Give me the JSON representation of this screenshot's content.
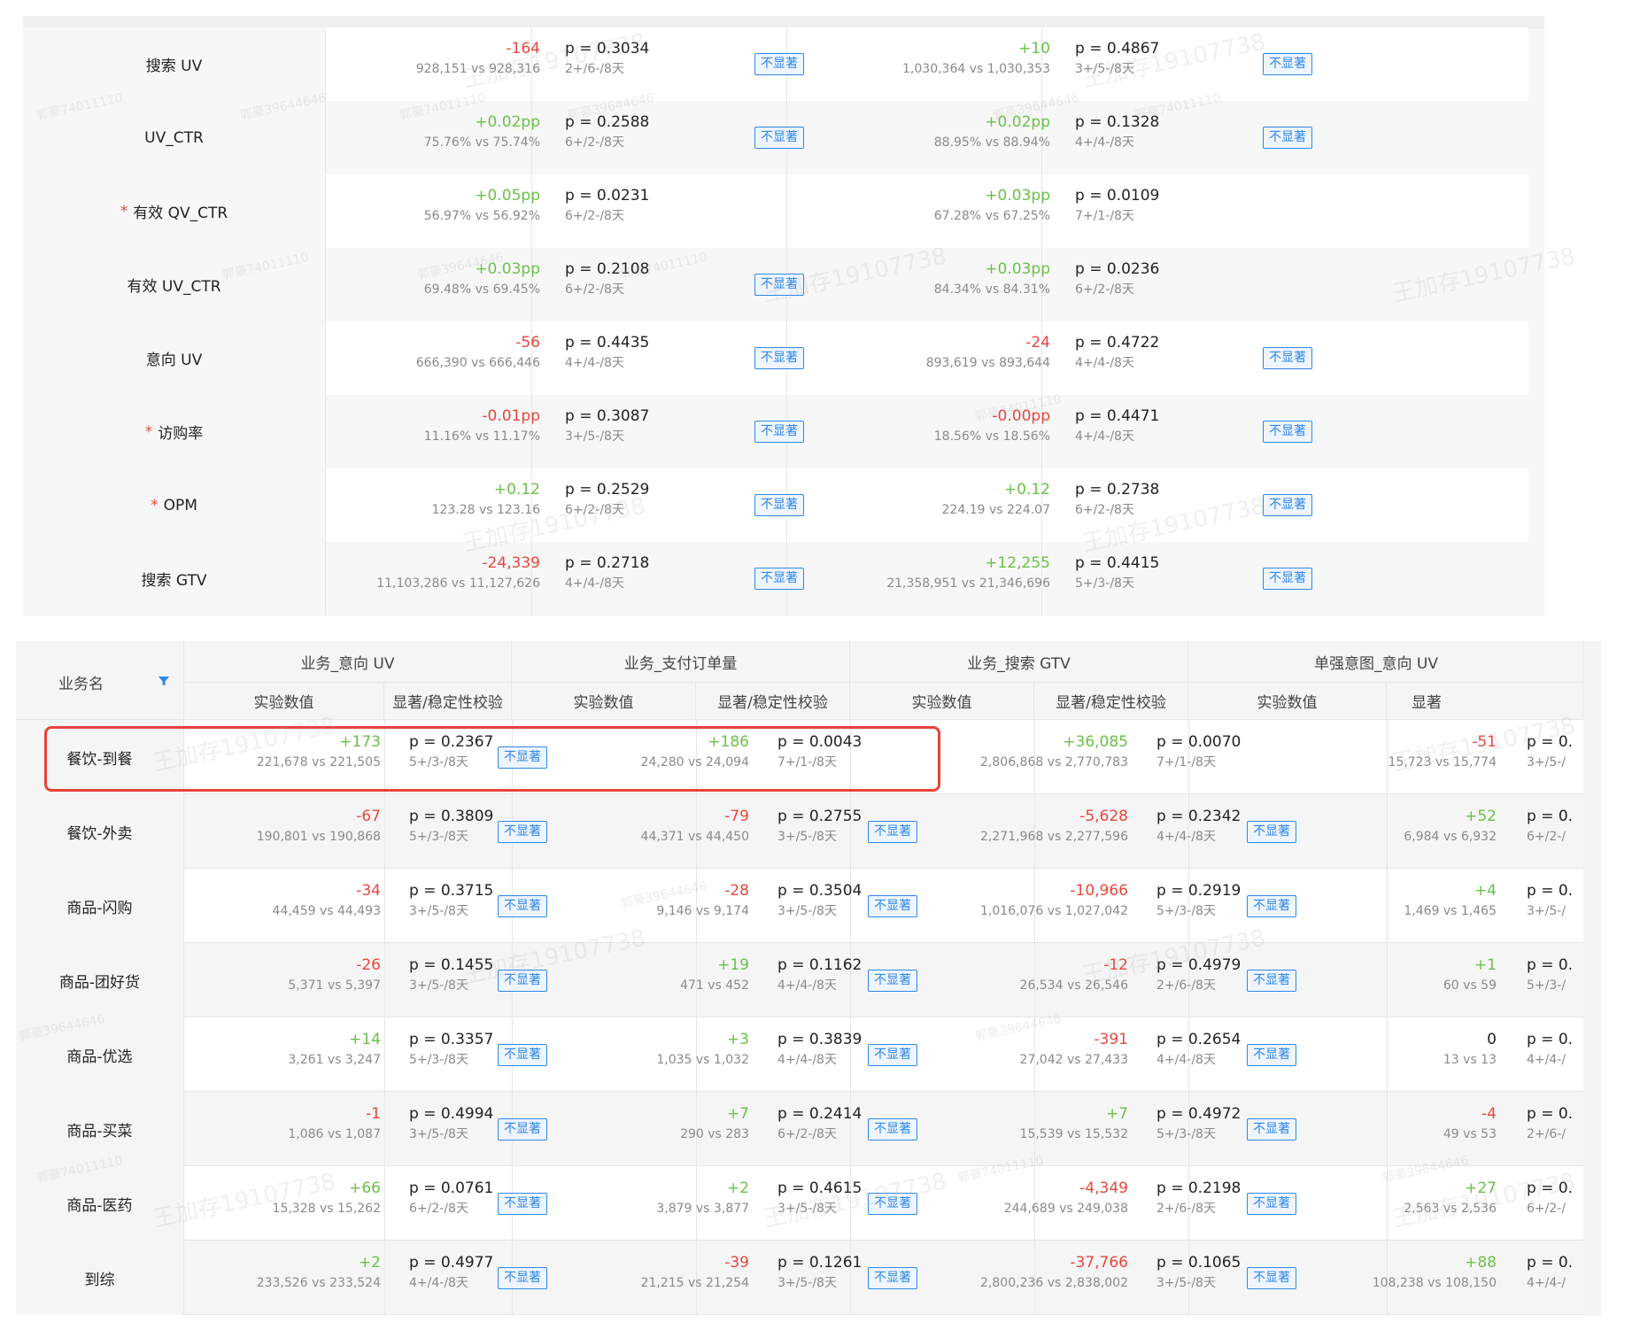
{
  "top_table": {
    "rows": [
      {
        "label": "搜索 UV",
        "required": false,
        "a": {
          "delta": "-164",
          "sign": "neg",
          "cmp": "928,151 vs 928,316",
          "p": "p = 0.3034",
          "stab": "2+/6-/8天",
          "badge": "不显著"
        },
        "b": {
          "delta": "+10",
          "sign": "pos",
          "cmp": "1,030,364 vs 1,030,353",
          "p": "p = 0.4867",
          "stab": "3+/5-/8天",
          "badge": "不显著"
        }
      },
      {
        "label": "UV_CTR",
        "required": false,
        "a": {
          "delta": "+0.02pp",
          "sign": "pos",
          "cmp": "75.76% vs 75.74%",
          "p": "p = 0.2588",
          "stab": "6+/2-/8天",
          "badge": "不显著"
        },
        "b": {
          "delta": "+0.02pp",
          "sign": "pos",
          "cmp": "88.95% vs 88.94%",
          "p": "p = 0.1328",
          "stab": "4+/4-/8天",
          "badge": "不显著"
        }
      },
      {
        "label": "有效 QV_CTR",
        "required": true,
        "a": {
          "delta": "+0.05pp",
          "sign": "pos",
          "cmp": "56.97% vs 56.92%",
          "p": "p = 0.0231",
          "stab": "6+/2-/8天",
          "badge": ""
        },
        "b": {
          "delta": "+0.03pp",
          "sign": "pos",
          "cmp": "67.28% vs 67.25%",
          "p": "p = 0.0109",
          "stab": "7+/1-/8天",
          "badge": ""
        }
      },
      {
        "label": "有效 UV_CTR",
        "required": false,
        "a": {
          "delta": "+0.03pp",
          "sign": "pos",
          "cmp": "69.48% vs 69.45%",
          "p": "p = 0.2108",
          "stab": "6+/2-/8天",
          "badge": "不显著"
        },
        "b": {
          "delta": "+0.03pp",
          "sign": "pos",
          "cmp": "84.34% vs 84.31%",
          "p": "p = 0.0236",
          "stab": "6+/2-/8天",
          "badge": ""
        }
      },
      {
        "label": "意向 UV",
        "required": false,
        "a": {
          "delta": "-56",
          "sign": "neg",
          "cmp": "666,390 vs 666,446",
          "p": "p = 0.4435",
          "stab": "4+/4-/8天",
          "badge": "不显著"
        },
        "b": {
          "delta": "-24",
          "sign": "neg",
          "cmp": "893,619 vs 893,644",
          "p": "p = 0.4722",
          "stab": "4+/4-/8天",
          "badge": "不显著"
        }
      },
      {
        "label": "访购率",
        "required": true,
        "a": {
          "delta": "-0.01pp",
          "sign": "neg",
          "cmp": "11.16% vs 11.17%",
          "p": "p = 0.3087",
          "stab": "3+/5-/8天",
          "badge": "不显著"
        },
        "b": {
          "delta": "-0.00pp",
          "sign": "neg",
          "cmp": "18.56% vs 18.56%",
          "p": "p = 0.4471",
          "stab": "4+/4-/8天",
          "badge": "不显著"
        }
      },
      {
        "label": "OPM",
        "required": true,
        "a": {
          "delta": "+0.12",
          "sign": "pos",
          "cmp": "123.28 vs 123.16",
          "p": "p = 0.2529",
          "stab": "6+/2-/8天",
          "badge": "不显著"
        },
        "b": {
          "delta": "+0.12",
          "sign": "pos",
          "cmp": "224.19 vs 224.07",
          "p": "p = 0.2738",
          "stab": "6+/2-/8天",
          "badge": "不显著"
        }
      },
      {
        "label": "搜索 GTV",
        "required": false,
        "a": {
          "delta": "-24,339",
          "sign": "neg",
          "cmp": "11,103,286 vs 11,127,626",
          "p": "p = 0.2718",
          "stab": "4+/4-/8天",
          "badge": "不显著"
        },
        "b": {
          "delta": "+12,255",
          "sign": "pos",
          "cmp": "21,358,951 vs 21,346,696",
          "p": "p = 0.4415",
          "stab": "5+/3-/8天",
          "badge": "不显著"
        }
      }
    ]
  },
  "bottom_table": {
    "name_header": "业务名",
    "groups": [
      "业务_意向 UV",
      "业务_支付订单量",
      "业务_搜索 GTV",
      "单强意图_意向 UV"
    ],
    "sub_value": "实验数值",
    "sub_sig": "显著/稳定性校验",
    "sub_sig_truncated": "显著",
    "rows": [
      {
        "label": "餐饮-到餐",
        "c": [
          {
            "delta": "+173",
            "sign": "pos",
            "cmp": "221,678 vs 221,505",
            "p": "p = 0.2367",
            "stab": "5+/3-/8天",
            "badge": "不显著"
          },
          {
            "delta": "+186",
            "sign": "pos",
            "cmp": "24,280 vs 24,094",
            "p": "p = 0.0043",
            "stab": "7+/1-/8天",
            "badge": ""
          },
          {
            "delta": "+36,085",
            "sign": "pos",
            "cmp": "2,806,868 vs 2,770,783",
            "p": "p = 0.0070",
            "stab": "7+/1-/8天",
            "badge": ""
          },
          {
            "delta": "-51",
            "sign": "neg",
            "cmp": "15,723 vs 15,774",
            "p": "p = 0.",
            "stab": "3+/5-/"
          }
        ]
      },
      {
        "label": "餐饮-外卖",
        "c": [
          {
            "delta": "-67",
            "sign": "neg",
            "cmp": "190,801 vs 190,868",
            "p": "p = 0.3809",
            "stab": "5+/3-/8天",
            "badge": "不显著"
          },
          {
            "delta": "-79",
            "sign": "neg",
            "cmp": "44,371 vs 44,450",
            "p": "p = 0.2755",
            "stab": "3+/5-/8天",
            "badge": "不显著"
          },
          {
            "delta": "-5,628",
            "sign": "neg",
            "cmp": "2,271,968 vs 2,277,596",
            "p": "p = 0.2342",
            "stab": "4+/4-/8天",
            "badge": "不显著"
          },
          {
            "delta": "+52",
            "sign": "pos",
            "cmp": "6,984 vs 6,932",
            "p": "p = 0.",
            "stab": "6+/2-/"
          }
        ]
      },
      {
        "label": "商品-闪购",
        "c": [
          {
            "delta": "-34",
            "sign": "neg",
            "cmp": "44,459 vs 44,493",
            "p": "p = 0.3715",
            "stab": "3+/5-/8天",
            "badge": "不显著"
          },
          {
            "delta": "-28",
            "sign": "neg",
            "cmp": "9,146 vs 9,174",
            "p": "p = 0.3504",
            "stab": "3+/5-/8天",
            "badge": "不显著"
          },
          {
            "delta": "-10,966",
            "sign": "neg",
            "cmp": "1,016,076 vs 1,027,042",
            "p": "p = 0.2919",
            "stab": "5+/3-/8天",
            "badge": "不显著"
          },
          {
            "delta": "+4",
            "sign": "pos",
            "cmp": "1,469 vs 1,465",
            "p": "p = 0.",
            "stab": "3+/5-/"
          }
        ]
      },
      {
        "label": "商品-团好货",
        "c": [
          {
            "delta": "-26",
            "sign": "neg",
            "cmp": "5,371 vs 5,397",
            "p": "p = 0.1455",
            "stab": "3+/5-/8天",
            "badge": "不显著"
          },
          {
            "delta": "+19",
            "sign": "pos",
            "cmp": "471 vs 452",
            "p": "p = 0.1162",
            "stab": "4+/4-/8天",
            "badge": "不显著"
          },
          {
            "delta": "-12",
            "sign": "neg",
            "cmp": "26,534 vs 26,546",
            "p": "p = 0.4979",
            "stab": "2+/6-/8天",
            "badge": "不显著"
          },
          {
            "delta": "+1",
            "sign": "pos",
            "cmp": "60 vs 59",
            "p": "p = 0.",
            "stab": "5+/3-/"
          }
        ]
      },
      {
        "label": "商品-优选",
        "c": [
          {
            "delta": "+14",
            "sign": "pos",
            "cmp": "3,261 vs 3,247",
            "p": "p = 0.3357",
            "stab": "5+/3-/8天",
            "badge": "不显著"
          },
          {
            "delta": "+3",
            "sign": "pos",
            "cmp": "1,035 vs 1,032",
            "p": "p = 0.3839",
            "stab": "4+/4-/8天",
            "badge": "不显著"
          },
          {
            "delta": "-391",
            "sign": "neg",
            "cmp": "27,042 vs 27,433",
            "p": "p = 0.2654",
            "stab": "4+/4-/8天",
            "badge": "不显著"
          },
          {
            "delta": "0",
            "sign": "zero",
            "cmp": "13 vs 13",
            "p": "p = 0.",
            "stab": "4+/4-/"
          }
        ]
      },
      {
        "label": "商品-买菜",
        "c": [
          {
            "delta": "-1",
            "sign": "neg",
            "cmp": "1,086 vs 1,087",
            "p": "p = 0.4994",
            "stab": "3+/5-/8天",
            "badge": "不显著"
          },
          {
            "delta": "+7",
            "sign": "pos",
            "cmp": "290 vs 283",
            "p": "p = 0.2414",
            "stab": "6+/2-/8天",
            "badge": "不显著"
          },
          {
            "delta": "+7",
            "sign": "pos",
            "cmp": "15,539 vs 15,532",
            "p": "p = 0.4972",
            "stab": "5+/3-/8天",
            "badge": "不显著"
          },
          {
            "delta": "-4",
            "sign": "neg",
            "cmp": "49 vs 53",
            "p": "p = 0.",
            "stab": "2+/6-/"
          }
        ]
      },
      {
        "label": "商品-医药",
        "c": [
          {
            "delta": "+66",
            "sign": "pos",
            "cmp": "15,328 vs 15,262",
            "p": "p = 0.0761",
            "stab": "6+/2-/8天",
            "badge": "不显著"
          },
          {
            "delta": "+2",
            "sign": "pos",
            "cmp": "3,879 vs 3,877",
            "p": "p = 0.4615",
            "stab": "3+/5-/8天",
            "badge": "不显著"
          },
          {
            "delta": "-4,349",
            "sign": "neg",
            "cmp": "244,689 vs 249,038",
            "p": "p = 0.2198",
            "stab": "2+/6-/8天",
            "badge": "不显著"
          },
          {
            "delta": "+27",
            "sign": "pos",
            "cmp": "2,563 vs 2,536",
            "p": "p = 0.",
            "stab": "6+/2-/"
          }
        ]
      },
      {
        "label": "到综",
        "c": [
          {
            "delta": "+2",
            "sign": "pos",
            "cmp": "233,526 vs 233,524",
            "p": "p = 0.4977",
            "stab": "4+/4-/8天",
            "badge": "不显著"
          },
          {
            "delta": "-39",
            "sign": "neg",
            "cmp": "21,215 vs 21,254",
            "p": "p = 0.1261",
            "stab": "3+/5-/8天",
            "badge": "不显著"
          },
          {
            "delta": "-37,766",
            "sign": "neg",
            "cmp": "2,800,236 vs 2,838,002",
            "p": "p = 0.1065",
            "stab": "3+/5-/8天",
            "badge": "不显著"
          },
          {
            "delta": "+88",
            "sign": "pos",
            "cmp": "108,238 vs 108,150",
            "p": "p = 0.",
            "stab": "4+/4-/"
          }
        ]
      }
    ]
  },
  "watermarks": [
    "王加存19107738",
    "郭豪74011110",
    "郭豪39644646"
  ],
  "colors": {
    "positive": "#6cc04a",
    "negative": "#e5483d",
    "badge": "#2f88e8",
    "highlight": "#e8423a"
  }
}
